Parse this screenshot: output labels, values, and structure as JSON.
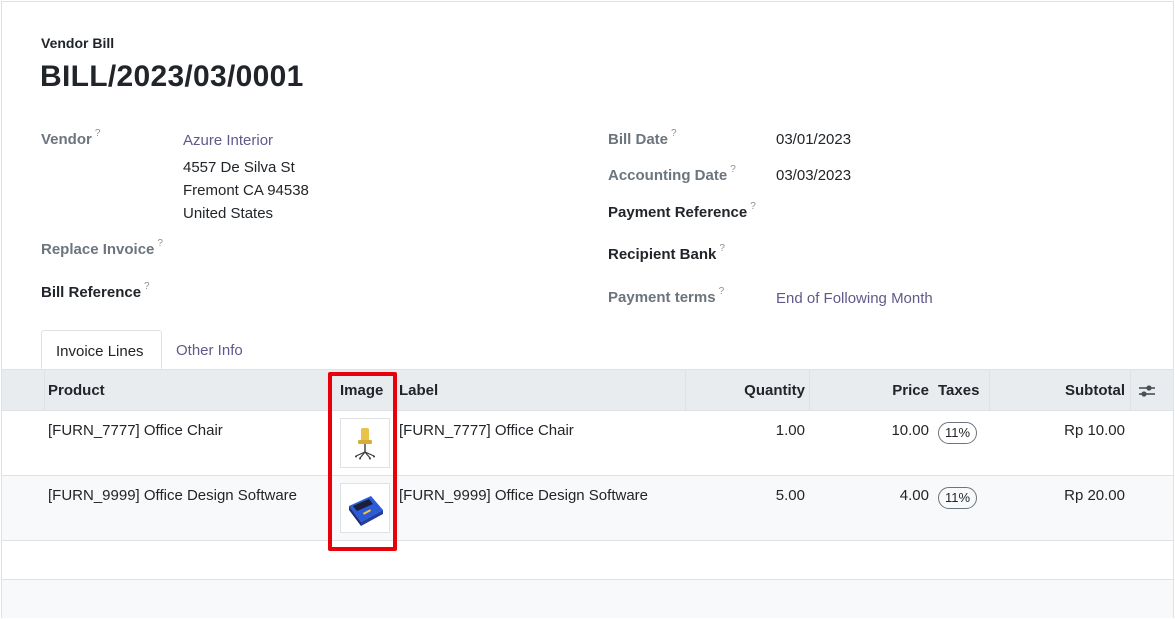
{
  "header": {
    "doc_type": "Vendor Bill",
    "title": "BILL/2023/03/0001"
  },
  "left_fields": {
    "vendor_label": "Vendor",
    "vendor_name": "Azure Interior",
    "vendor_address": [
      "4557 De Silva St",
      "Fremont CA 94538",
      "United States"
    ],
    "replace_invoice_label": "Replace Invoice",
    "bill_reference_label": "Bill Reference"
  },
  "right_fields": {
    "bill_date_label": "Bill Date",
    "bill_date": "03/01/2023",
    "accounting_date_label": "Accounting Date",
    "accounting_date": "03/03/2023",
    "payment_reference_label": "Payment Reference",
    "recipient_bank_label": "Recipient Bank",
    "payment_terms_label": "Payment terms",
    "payment_terms": "End of Following Month"
  },
  "help_mark": "?",
  "tabs": [
    {
      "label": "Invoice Lines",
      "active": true
    },
    {
      "label": "Other Info",
      "active": false
    }
  ],
  "table": {
    "columns": [
      "Product",
      "Image",
      "Label",
      "Quantity",
      "Price",
      "Taxes",
      "Subtotal"
    ],
    "rows": [
      {
        "product": "[FURN_7777] Office Chair",
        "image": "office-chair-image",
        "label": "[FURN_7777] Office Chair",
        "quantity": "1.00",
        "price": "10.00",
        "taxes": "11%",
        "subtotal": "Rp 10.00"
      },
      {
        "product": "[FURN_9999] Office Design Software",
        "image": "software-box-image",
        "label": "[FURN_9999] Office Design Software",
        "quantity": "5.00",
        "price": "4.00",
        "taxes": "11%",
        "subtotal": "Rp 20.00"
      }
    ]
  },
  "colors": {
    "link": "#5f5a8a",
    "highlight": "#e8000b",
    "header_bg": "#e9ecef"
  }
}
